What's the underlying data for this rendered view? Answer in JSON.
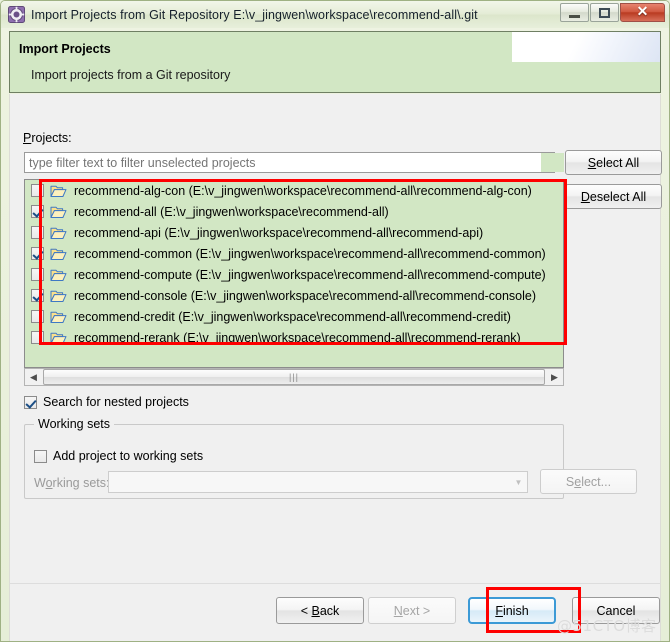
{
  "window": {
    "title": "Import Projects from Git Repository E:\\v_jingwen\\workspace\\recommend-all\\.git",
    "icon": "git-repository-icon",
    "minimize_label": "",
    "maximize_label": "",
    "close_label": "✕"
  },
  "header": {
    "title": "Import Projects",
    "description": "Import projects from a Git repository",
    "background_color": "#d2e7c4"
  },
  "main": {
    "projects_label": "Projects:",
    "filter": {
      "value": "",
      "placeholder": "type filter text to filter unselected projects"
    },
    "buttons": {
      "select_all": "Select All",
      "deselect_all": "Deselect All"
    },
    "projects": [
      {
        "checked": false,
        "label": "recommend-alg-con (E:\\v_jingwen\\workspace\\recommend-all\\recommend-alg-con)"
      },
      {
        "checked": true,
        "label": "recommend-all (E:\\v_jingwen\\workspace\\recommend-all)"
      },
      {
        "checked": false,
        "label": "recommend-api (E:\\v_jingwen\\workspace\\recommend-all\\recommend-api)"
      },
      {
        "checked": true,
        "label": "recommend-common (E:\\v_jingwen\\workspace\\recommend-all\\recommend-common)"
      },
      {
        "checked": false,
        "label": "recommend-compute (E:\\v_jingwen\\workspace\\recommend-all\\recommend-compute)"
      },
      {
        "checked": true,
        "label": "recommend-console (E:\\v_jingwen\\workspace\\recommend-all\\recommend-console)"
      },
      {
        "checked": false,
        "label": "recommend-credit (E:\\v_jingwen\\workspace\\recommend-all\\recommend-credit)"
      },
      {
        "checked": false,
        "label": "recommend-rerank (E:\\v_jingwen\\workspace\\recommend-all\\recommend-rerank)"
      }
    ],
    "scroll": {
      "left_arrow": "◀",
      "right_arrow": "▶",
      "thumb_grip": "|||"
    },
    "nested": {
      "checked": true,
      "label": "Search for nested projects"
    },
    "working_sets": {
      "group_label": "Working sets",
      "add_checkbox": {
        "checked": false,
        "label": "Add project to working sets"
      },
      "combo_label": "Working sets:",
      "combo_value": "",
      "combo_arrow": "▼",
      "select_button": "Select..."
    }
  },
  "footer": {
    "back": "< Back",
    "next": "Next >",
    "finish": "Finish",
    "cancel": "Cancel"
  },
  "annotations": {
    "list_box_color": "#fe0000",
    "finish_box_color": "#fe0000",
    "watermark": "@51CTO博客"
  }
}
